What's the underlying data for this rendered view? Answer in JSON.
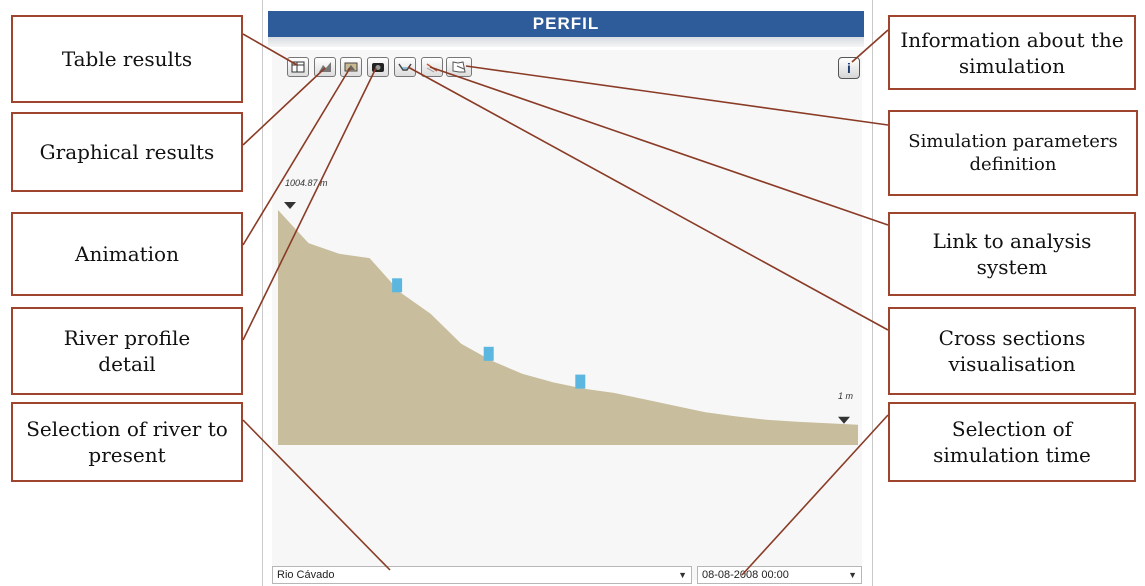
{
  "panel": {
    "title": "PERFIL",
    "start_elevation": "1004.87 m",
    "end_elevation": "1 m",
    "info_button": "i"
  },
  "toolbar": {
    "buttons": [
      {
        "name": "table-results",
        "icon": "table-icon"
      },
      {
        "name": "graphical-results",
        "icon": "chart-icon"
      },
      {
        "name": "animation",
        "icon": "film-icon"
      },
      {
        "name": "river-profile-detail",
        "icon": "camera-icon"
      },
      {
        "name": "cross-sections-visualisation",
        "icon": "cross-section-icon"
      },
      {
        "name": "link-analysis-system",
        "icon": "link-icon"
      },
      {
        "name": "simulation-parameters",
        "icon": "map-icon"
      }
    ]
  },
  "bottom_bar": {
    "river_select": "Rio Cávado",
    "time_select": "08-08-2008 00:00"
  },
  "callouts": {
    "table_results": "Table results",
    "graphical_results": "Graphical results",
    "animation": "Animation",
    "river_profile_detail": "River profile detail",
    "selection_river": "Selection of river to present",
    "information_simulation": "Information about the simulation",
    "simulation_parameters": "Simulation parameters definition",
    "link_analysis": "Link to analysis system",
    "cross_sections": "Cross sections visualisation",
    "selection_time": "Selection of simulation time"
  },
  "chart_data": {
    "type": "area",
    "series": [
      {
        "values": [
          1004.87,
          850,
          800,
          780,
          620,
          520,
          380,
          300,
          240,
          200,
          170,
          150,
          120,
          90,
          60,
          40,
          25,
          15,
          8,
          1
        ]
      }
    ],
    "water_markers": [
      4,
      7,
      10
    ],
    "colors": {
      "terrain": "#c8bd9c",
      "water": "#5bb7df"
    }
  }
}
